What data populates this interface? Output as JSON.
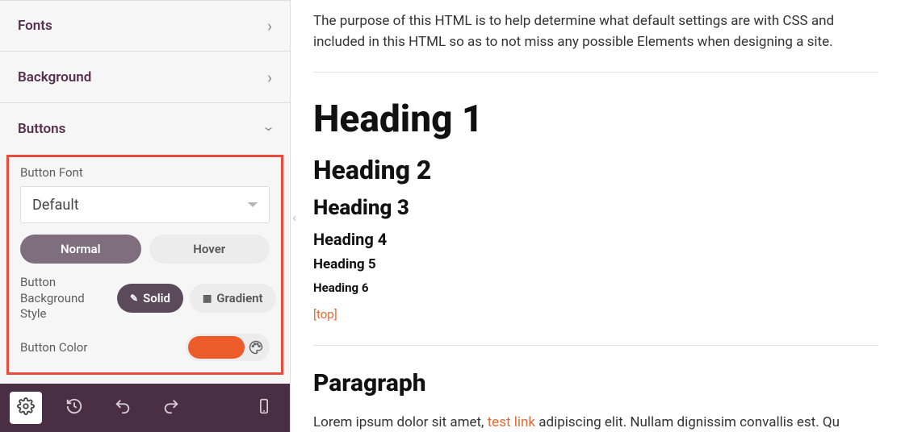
{
  "sidebar": {
    "sections": {
      "fonts": "Fonts",
      "background": "Background",
      "buttons": "Buttons"
    },
    "button_font_label": "Button Font",
    "button_font_value": "Default",
    "state_tabs": {
      "normal": "Normal",
      "hover": "Hover"
    },
    "bg_style_label": "Button Background Style",
    "bg_style": {
      "solid": "Solid",
      "gradient": "Gradient"
    },
    "button_color_label": "Button Color",
    "button_color_value": "#ec5b29"
  },
  "preview": {
    "intro": "The purpose of this HTML is to help determine what default settings are with CSS and included in this HTML so as to not miss any possible Elements when designing a site.",
    "headings": {
      "h1": "Heading 1",
      "h2": "Heading 2",
      "h3": "Heading 3",
      "h4": "Heading 4",
      "h5": "Heading 5",
      "h6": "Heading 6"
    },
    "top_link": "[top]",
    "paragraph_heading": "Paragraph",
    "paragraph_pre": "Lorem ipsum dolor sit amet, ",
    "paragraph_link": "test link",
    "paragraph_post": " adipiscing elit. Nullam dignissim convallis est. Qu"
  }
}
